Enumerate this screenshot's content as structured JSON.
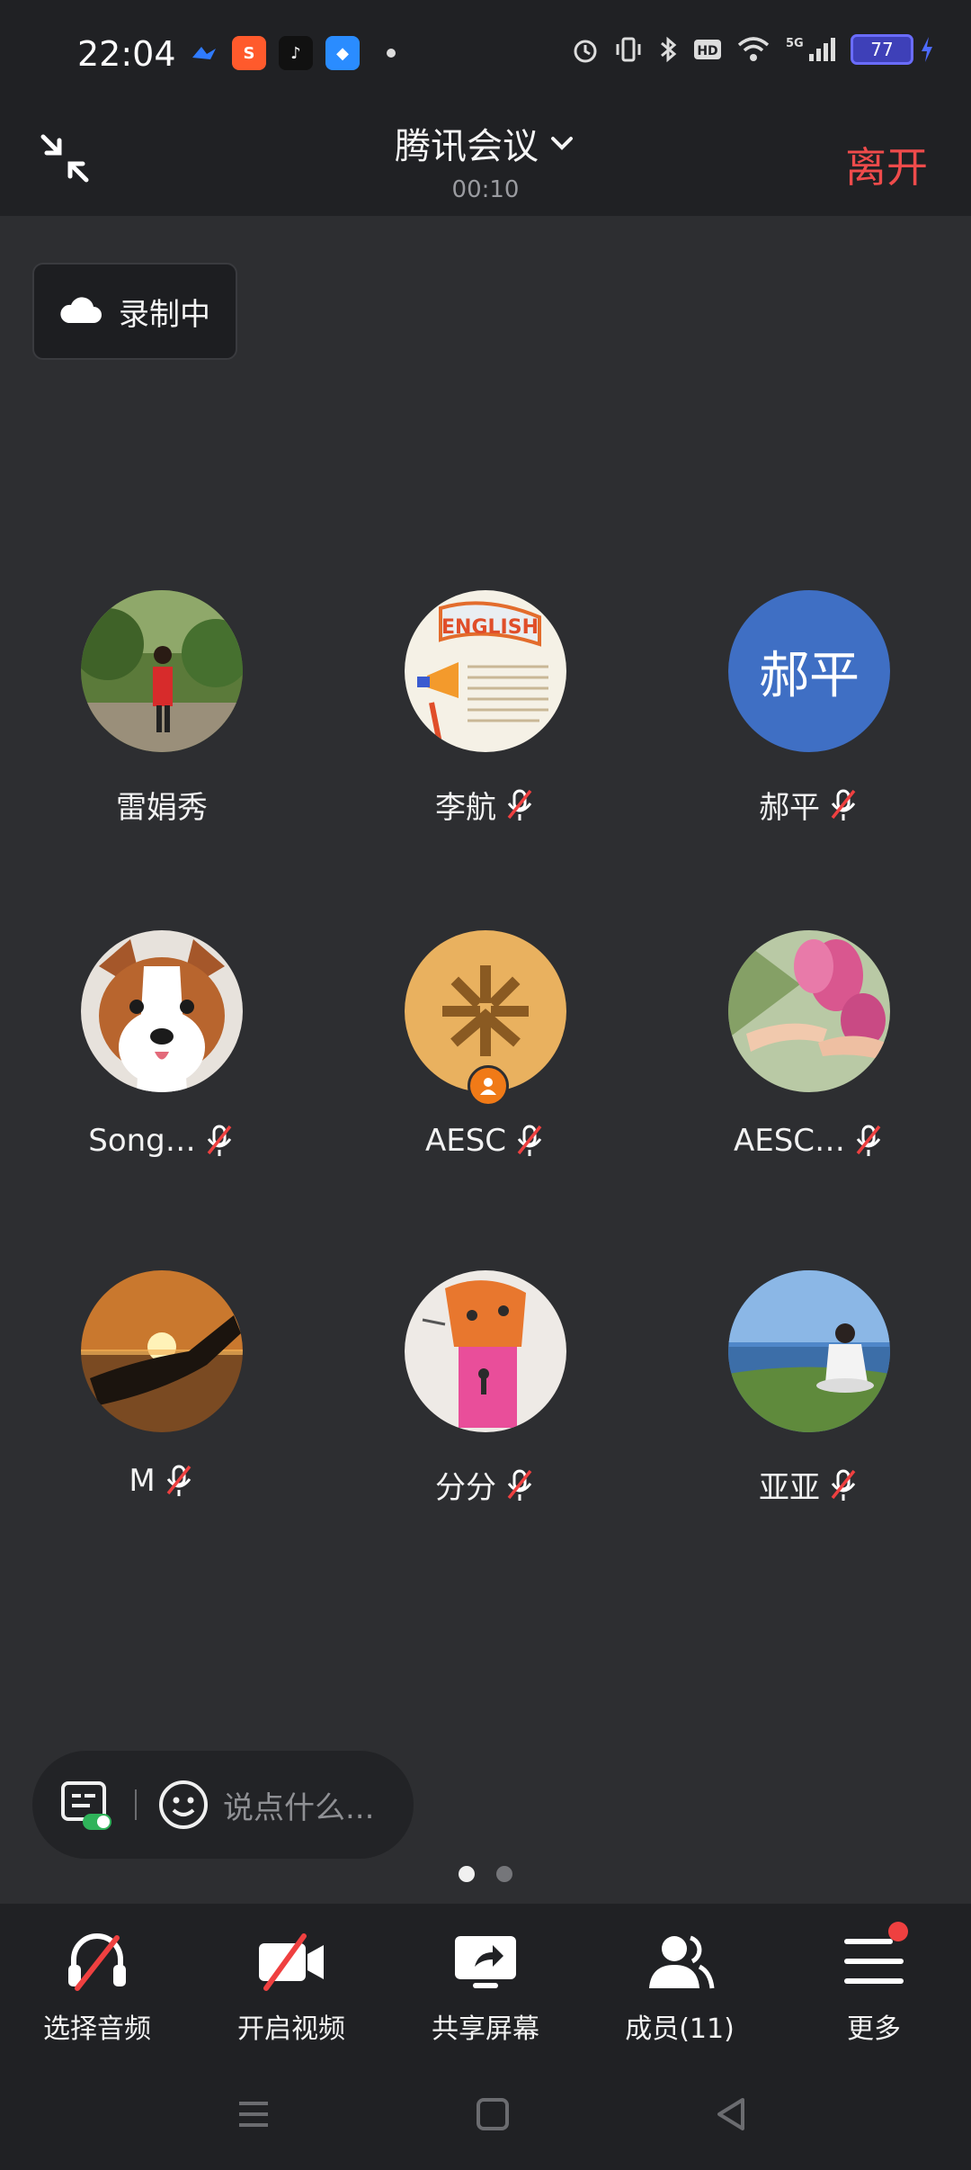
{
  "status_bar": {
    "time": "22:04",
    "app_icons": [
      "lark-icon",
      "shopping-app-icon",
      "tiktok-icon",
      "browser-app-icon"
    ],
    "battery": "77"
  },
  "header": {
    "title": "腾讯会议",
    "timer": "00:10",
    "leave_label": "离开"
  },
  "recording": {
    "label": "录制中"
  },
  "participants": [
    {
      "name": "雷娟秀",
      "muted": false,
      "avatar": "photo-person-red-coat",
      "host": false
    },
    {
      "name": "李航",
      "muted": true,
      "avatar": "photo-english-poster",
      "host": false
    },
    {
      "name": "郝平",
      "muted": true,
      "avatar": "initials",
      "initials": "郝平",
      "bg": "#3f6fc4",
      "host": false
    },
    {
      "name": "Song…",
      "muted": true,
      "avatar": "photo-corgi",
      "host": false
    },
    {
      "name": "AESC",
      "muted": true,
      "avatar": "logo-aesc",
      "bg": "#e9b15f",
      "host": true
    },
    {
      "name": "AESC…",
      "muted": true,
      "avatar": "photo-magnolia",
      "host": false
    },
    {
      "name": "M",
      "muted": true,
      "avatar": "photo-sunset-hand",
      "host": false
    },
    {
      "name": "分分",
      "muted": true,
      "avatar": "photo-child-drawing",
      "host": false
    },
    {
      "name": "亚亚",
      "muted": true,
      "avatar": "photo-sea-meditation",
      "host": false
    }
  ],
  "chat": {
    "placeholder": "说点什么..."
  },
  "pager": {
    "pages": 2,
    "active": 0
  },
  "toolbar": [
    {
      "label": "选择音频",
      "icon": "headset-off-icon"
    },
    {
      "label": "开启视频",
      "icon": "video-off-icon"
    },
    {
      "label": "共享屏幕",
      "icon": "share-screen-icon"
    },
    {
      "label": "成员(11)",
      "icon": "members-icon"
    },
    {
      "label": "更多",
      "icon": "more-menu-icon",
      "badge": true
    }
  ],
  "colors": {
    "leave": "#ef4b4b",
    "badge": "#ef4040",
    "host": "#f07a17"
  }
}
